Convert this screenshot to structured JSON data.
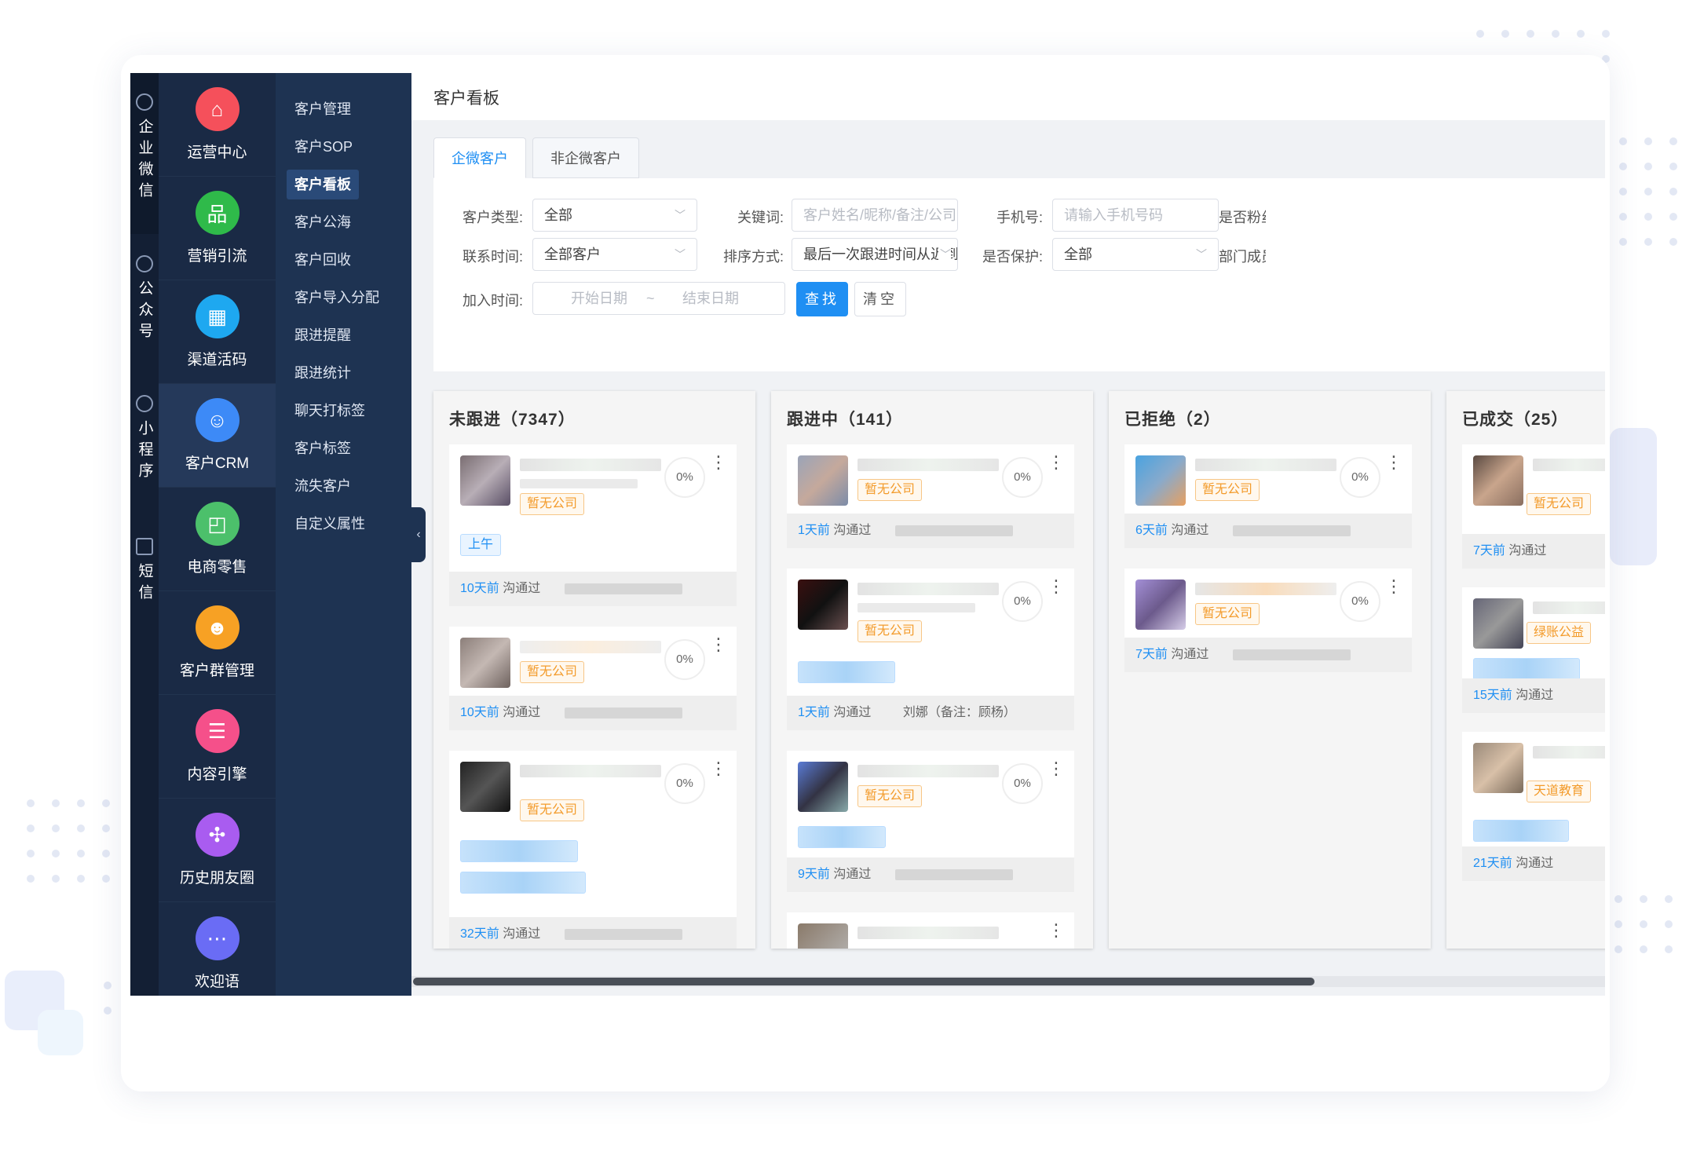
{
  "rail": {
    "items": [
      {
        "label": "企业微信",
        "icon": "chat-bubble-icon"
      },
      {
        "label": "公众号",
        "icon": "wechat-icon"
      },
      {
        "label": "小程序",
        "icon": "miniprogram-icon"
      },
      {
        "label": "短信",
        "icon": "mail-icon"
      }
    ]
  },
  "modules": [
    {
      "label": "运营中心",
      "icon": "home-icon",
      "color": "#f5505b",
      "glyph": "⌂"
    },
    {
      "label": "营销引流",
      "icon": "org-chart-icon",
      "color": "#2fba4a",
      "glyph": "品"
    },
    {
      "label": "渠道活码",
      "icon": "qrcode-icon",
      "color": "#1ea8f0",
      "glyph": "▦"
    },
    {
      "label": "客户CRM",
      "icon": "customer-icon",
      "color": "#3d8af7",
      "glyph": "☺"
    },
    {
      "label": "电商零售",
      "icon": "shopping-bag-icon",
      "color": "#4cc06b",
      "glyph": "◰"
    },
    {
      "label": "客户群管理",
      "icon": "group-icon",
      "color": "#f7a124",
      "glyph": "☻"
    },
    {
      "label": "内容引擎",
      "icon": "document-icon",
      "color": "#f5508a",
      "glyph": "☰"
    },
    {
      "label": "历史朋友圈",
      "icon": "moments-icon",
      "color": "#a95cf0",
      "glyph": "✣"
    },
    {
      "label": "欢迎语",
      "icon": "message-icon",
      "color": "#6a6cf5",
      "glyph": "⋯"
    }
  ],
  "submenu": [
    "客户管理",
    "客户SOP",
    "客户看板",
    "客户公海",
    "客户回收",
    "客户导入分配",
    "跟进提醒",
    "跟进统计",
    "聊天打标签",
    "客户标签",
    "流失客户",
    "自定义属性"
  ],
  "page": {
    "title": "客户看板",
    "tabs": [
      "企微客户",
      "非企微客户"
    ],
    "filters": {
      "customer_type_label": "客户类型:",
      "customer_type_value": "全部",
      "keyword_label": "关键词:",
      "keyword_placeholder": "客户姓名/昵称/备注/公司名称",
      "phone_label": "手机号:",
      "phone_placeholder": "请输入手机号码",
      "fans_label": "是否粉丝",
      "contact_time_label": "联系时间:",
      "contact_time_value": "全部客户",
      "sort_label": "排序方式:",
      "sort_value": "最后一次跟进时间从近到远",
      "protect_label": "是否保护:",
      "protect_value": "全部",
      "dept_label": "部门成员",
      "join_time_label": "加入时间:",
      "start_date": "开始日期",
      "date_sep": "~",
      "end_date": "结束日期",
      "search_btn": "查找",
      "clear_btn": "清空"
    }
  },
  "board": {
    "columns": [
      {
        "title": "未跟进（7347）",
        "cards": [
          {
            "company": "暂无公司",
            "pct": "0%",
            "time_tag": "上午",
            "days": "10天前",
            "status": "沟通过",
            "note": ""
          },
          {
            "company": "暂无公司",
            "pct": "0%",
            "days": "10天前",
            "status": "沟通过",
            "note": ""
          },
          {
            "company": "暂无公司",
            "pct": "0%",
            "days": "32天前",
            "status": "沟通过",
            "note": ""
          }
        ]
      },
      {
        "title": "跟进中（141）",
        "cards": [
          {
            "company": "暂无公司",
            "pct": "0%",
            "days": "1天前",
            "status": "沟通过",
            "note": ""
          },
          {
            "company": "暂无公司",
            "pct": "0%",
            "days": "1天前",
            "status": "沟通过",
            "note": "刘娜（备注：顾杨）"
          },
          {
            "company": "暂无公司",
            "pct": "0%",
            "days": "9天前",
            "status": "沟通过",
            "note": ""
          }
        ]
      },
      {
        "title": "已拒绝（2）",
        "cards": [
          {
            "company": "暂无公司",
            "pct": "0%",
            "days": "6天前",
            "status": "沟通过",
            "note": ""
          },
          {
            "company": "暂无公司",
            "pct": "0%",
            "days": "7天前",
            "status": "沟通过",
            "note": ""
          }
        ]
      },
      {
        "title": "已成交（25）",
        "cards": [
          {
            "company": "暂无公司",
            "days": "7天前",
            "status": "沟通过"
          },
          {
            "company": "绿账公益",
            "days": "15天前",
            "status": "沟通过"
          },
          {
            "company": "天道教育",
            "days": "21天前",
            "status": "沟通过"
          }
        ]
      }
    ]
  },
  "colors": {
    "accent": "#1f8ff3",
    "sidebar_dark": "#1a2a45",
    "submenu_bg": "#1e3352",
    "company_tag": "#f39b2b"
  }
}
